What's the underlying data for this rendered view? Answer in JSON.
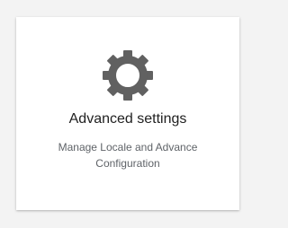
{
  "card": {
    "icon": "gear-icon",
    "title": "Advanced settings",
    "description": "Manage Locale and Advance Configuration"
  },
  "colors": {
    "icon": "#616161",
    "card_bg": "#ffffff",
    "page_bg": "#f3f3f3"
  }
}
